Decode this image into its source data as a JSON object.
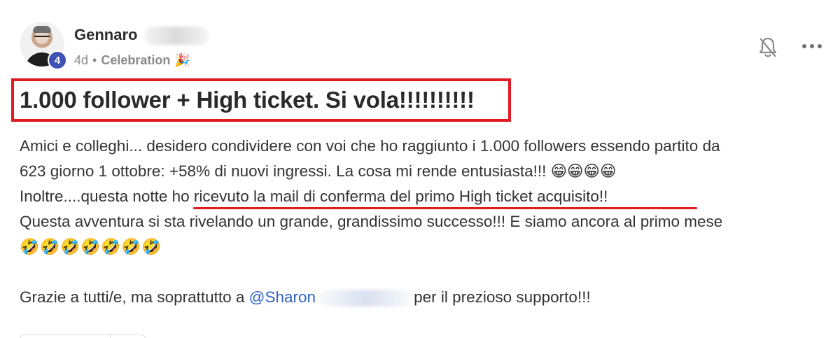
{
  "post": {
    "author": {
      "name": "Gennaro",
      "level": "4",
      "time": "4d",
      "separator": "•",
      "category": "Celebration",
      "category_emoji": "🎉"
    },
    "title": "1.000 follower + High ticket. Si vola!!!!!!!!!!",
    "body": {
      "line1": "Amici e colleghi... desidero condividere con voi che ho raggiunto i 1.000 followers essendo partito da",
      "line2": "623 giorno 1 ottobre: +58% di nuovi ingressi. La cosa mi rende entusiasta!!! 😁😁😁😁",
      "line3_prefix": "Inoltre....questa notte ",
      "line3_highlight": "ho ricevuto la mail di conferma del primo High ticket acquisito!!",
      "line4": "Questa avventura si sta rivelando un grande, grandissimo successo!!! E siamo ancora al primo mese",
      "line5": "🤣🤣🤣🤣🤣🤣🤣",
      "thanks_prefix": "Grazie a tutti/e, ma soprattutto a ",
      "mention": "@Sharon",
      "thanks_suffix": "per il prezioso supporto!!!"
    },
    "icons": {
      "bell": "bell-off-icon",
      "more": "more-horizontal-icon"
    },
    "colors": {
      "highlight_red": "#e11b22",
      "mention_blue": "#2f63c8",
      "level_badge": "#3f51b5"
    }
  }
}
